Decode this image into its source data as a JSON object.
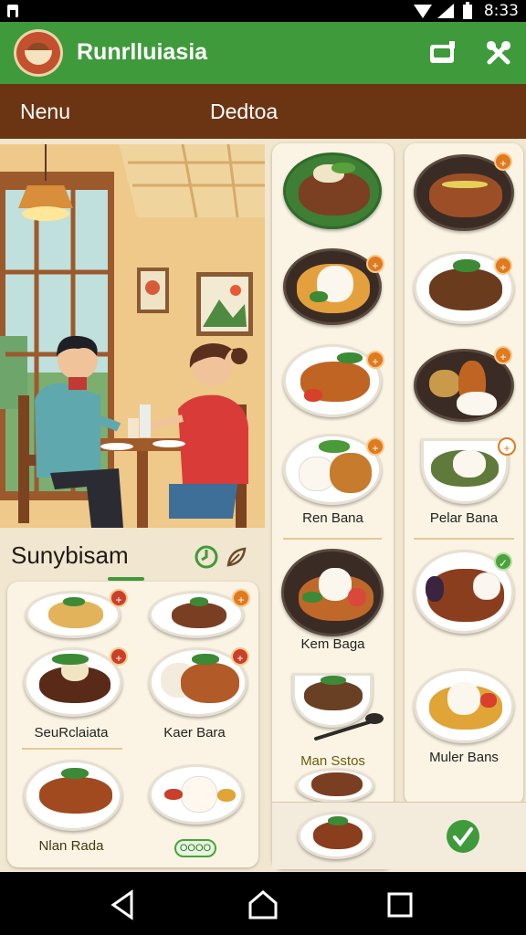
{
  "status_bar": {
    "time": "8:33"
  },
  "app": {
    "title": "Runrlluiasia",
    "brand_color": "#3f9a3c",
    "subbar_color": "#6b3412"
  },
  "toolbar": {
    "icons": [
      "cart-icon",
      "tools-icon"
    ]
  },
  "subbar": {
    "menu_label": "Nenu",
    "section_label": "Dedtoa"
  },
  "left": {
    "section_title": "Sunybisam",
    "icons": [
      "refresh-icon",
      "leaf-icon"
    ]
  },
  "left_grid": {
    "labels": [
      "SeuRclaiata",
      "Kaer Bara",
      "Nlan Rada"
    ],
    "button_label": "OOOO"
  },
  "mid_column": {
    "labels": [
      "Ren Bana",
      "Kem Baga",
      "Man Sstos"
    ]
  },
  "right_column": {
    "labels": [
      "Pelar Bana",
      "Muler Bans"
    ]
  },
  "nav": {
    "icons": [
      "back-icon",
      "home-icon",
      "recents-icon"
    ]
  }
}
